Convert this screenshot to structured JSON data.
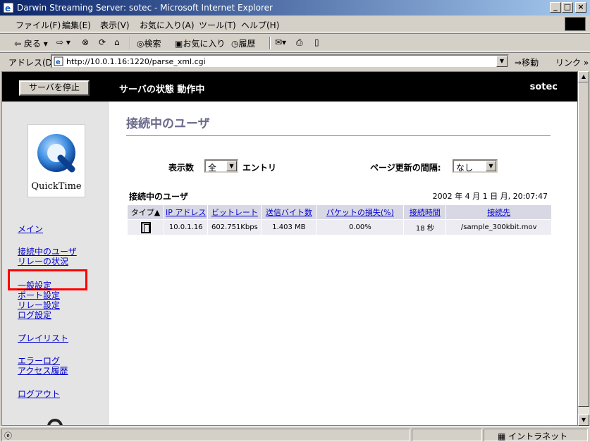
{
  "window": {
    "title": "Darwin Streaming Server: sotec - Microsoft Internet Explorer",
    "buttons": {
      "minimize": "_",
      "maximize": "□",
      "close": "×"
    }
  },
  "menubar": {
    "items": [
      "ファイル(F)",
      "編集(E)",
      "表示(V)",
      "お気に入り(A)",
      "ツール(T)",
      "ヘルプ(H)"
    ]
  },
  "toolbar": {
    "back": "戻る",
    "search": "検索",
    "favorites": "お気に入り",
    "history": "履歴"
  },
  "addressbar": {
    "label": "アドレス(D)",
    "url": "http://10.0.1.16:1220/parse_xml.cgi",
    "go": "移動",
    "links": "リンク »"
  },
  "header": {
    "stop_button": "サーバを停止",
    "status": "サーバの状態 動作中",
    "host": "sotec"
  },
  "sidebar": {
    "logo_text": "QuickTime",
    "links": [
      "メイン",
      "接続中のユーザ",
      "リレーの状況",
      "一般設定",
      "ポート設定",
      "リレー設定",
      "ログ設定",
      "プレイリスト",
      "エラーログ",
      "アクセス履歴",
      "ログアウト"
    ]
  },
  "main": {
    "title": "接続中のユーザ",
    "display_count_label": "表示数",
    "display_count_value": "全",
    "entry_label": "エントリ",
    "refresh_label": "ページ更新の間隔:",
    "refresh_value": "なし",
    "table_caption": "接続中のユーザ",
    "timestamp": "2002 年 4 月 1 日 月, 20:07:47",
    "columns": [
      "タイプ▲",
      "IP アドレス",
      "ビットレート",
      "送信バイト数",
      "パケットの損失(%)",
      "接続時間",
      "接続先"
    ],
    "rows": [
      {
        "ip": "10.0.1.16",
        "bitrate": "602.751Kbps",
        "bytes": "1.403 MB",
        "loss": "0.00%",
        "time": "18 秒",
        "dest": "/sample_300kbit.mov"
      }
    ]
  },
  "statusbar": {
    "zone": "イントラネット"
  },
  "colors": {
    "highlight": "#ff0000",
    "link": "#0000cc",
    "header_bg": "#000000"
  }
}
